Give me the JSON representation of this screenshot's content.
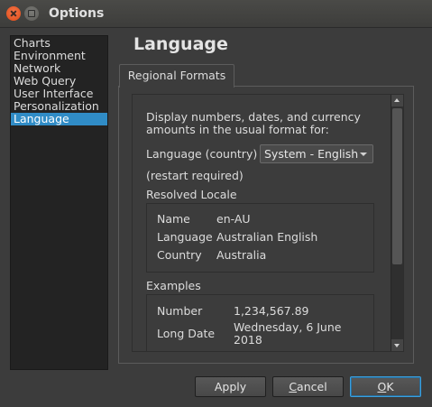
{
  "window": {
    "title": "Options"
  },
  "sidebar": {
    "items": [
      {
        "label": "Charts"
      },
      {
        "label": "Environment"
      },
      {
        "label": "Network"
      },
      {
        "label": "Web Query"
      },
      {
        "label": "User Interface"
      },
      {
        "label": "Personalization"
      },
      {
        "label": "Language",
        "selected": true
      }
    ]
  },
  "page": {
    "title": "Language"
  },
  "tabs": [
    {
      "label": "Regional Formats",
      "active": true
    }
  ],
  "regional": {
    "description": "Display numbers, dates, and currency amounts in the usual format for:",
    "language_label": "Language (country)",
    "language_value": "System - English",
    "restart_note": "(restart required)",
    "resolved_heading": "Resolved Locale",
    "resolved": [
      {
        "key": "Name",
        "value": "en-AU"
      },
      {
        "key": "Language",
        "value": "Australian English"
      },
      {
        "key": "Country",
        "value": "Australia"
      }
    ],
    "examples_heading": "Examples",
    "examples": [
      {
        "key": "Number",
        "value": "1,234,567.89"
      },
      {
        "key": "Long Date",
        "value": "Wednesday, 6 June 2018"
      }
    ]
  },
  "buttons": {
    "apply": "Apply",
    "cancel_mnemonic": "C",
    "cancel_rest": "ancel",
    "ok_mnemonic": "O",
    "ok_rest": "K"
  },
  "colors": {
    "selection": "#308cc6",
    "background": "#3c3c3c"
  }
}
